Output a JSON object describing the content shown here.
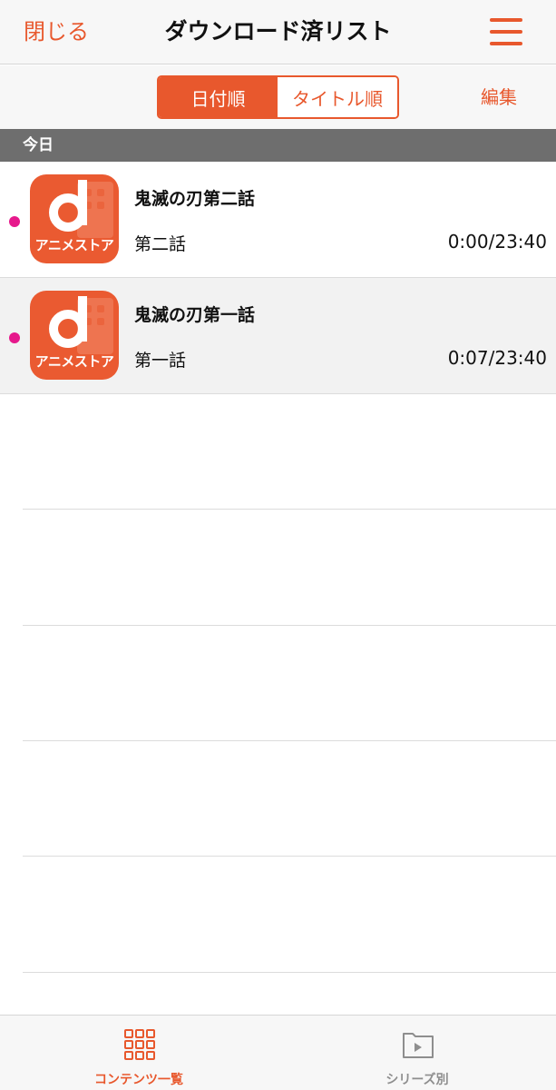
{
  "header": {
    "close_label": "閉じる",
    "title": "ダウンロード済リスト",
    "menu_icon": "hamburger-menu-icon"
  },
  "sort": {
    "options": [
      "日付順",
      "タイトル順"
    ],
    "selected": "日付順",
    "edit_label": "編集"
  },
  "section": {
    "header": "今日"
  },
  "items": [
    {
      "thumb_label": "アニメストア",
      "title": "鬼滅の刃第二話",
      "subtitle": "第二話",
      "progress": "0:00/23:40",
      "unread": true
    },
    {
      "thumb_label": "アニメストア",
      "title": "鬼滅の刃第一話",
      "subtitle": "第一話",
      "progress": "0:07/23:40",
      "unread": true
    }
  ],
  "tabs": [
    {
      "label": "コンテンツ一覧",
      "icon": "grid-icon",
      "active": true
    },
    {
      "label": "シリーズ別",
      "icon": "folder-play-icon",
      "active": false
    }
  ],
  "colors": {
    "accent": "#e8582d",
    "unread_dot": "#e6198c",
    "section_bg": "#6e6e6e"
  }
}
